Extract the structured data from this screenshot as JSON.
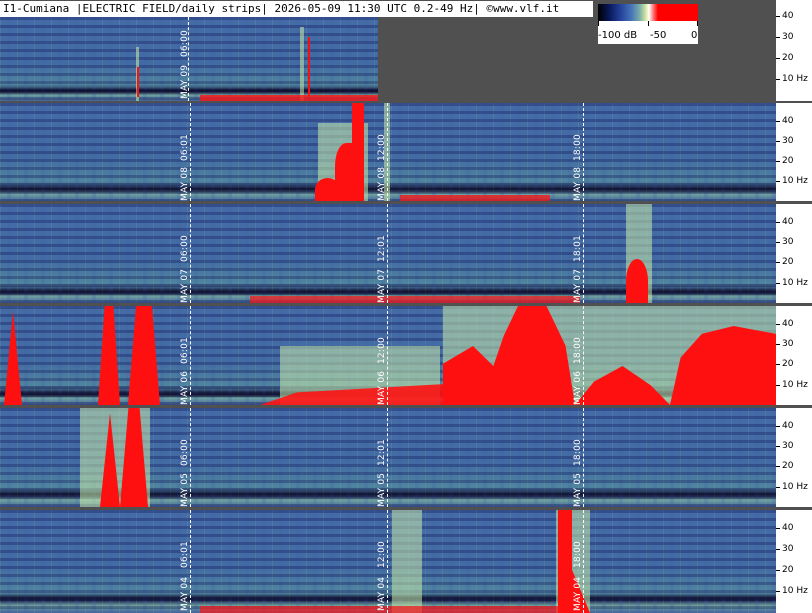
{
  "header": {
    "title": "I1-Cumiana |ELECTRIC FIELD/daily strips| 2026-05-09 11:30 UTC 0.2-49 Hz| ©www.vlf.it"
  },
  "colorbar": {
    "labels": [
      "-100 dB",
      "-50",
      "0"
    ],
    "colors": [
      "#000000",
      "#2848a0",
      "#7fb0a8",
      "#ffffff",
      "#ff0000"
    ]
  },
  "axis": {
    "ticks": [
      "40",
      "30",
      "20",
      "10 Hz"
    ]
  },
  "strips": [
    {
      "name": "strip-may09",
      "labels": [
        "MAY 09",
        "06:00"
      ]
    },
    {
      "name": "strip-may08",
      "labels": [
        "MAY 08",
        "06:01",
        "MAY 08",
        "12:00",
        "MAY 08",
        "18:00"
      ]
    },
    {
      "name": "strip-may07",
      "labels": [
        "MAY 07",
        "06:00",
        "MAY 07",
        "12:01",
        "MAY 07",
        "18:01"
      ]
    },
    {
      "name": "strip-may06",
      "labels": [
        "MAY 06",
        "06:01",
        "MAY 06",
        "12:00",
        "MAY 06",
        "18:00"
      ]
    },
    {
      "name": "strip-may05",
      "labels": [
        "MAY 05",
        "06:00",
        "MAY 05",
        "12:01",
        "MAY 05",
        "18:00"
      ]
    },
    {
      "name": "strip-may04",
      "labels": [
        "MAY 04",
        "06:01",
        "MAY 04",
        "12:00",
        "MAY 04",
        "18:00"
      ]
    }
  ]
}
